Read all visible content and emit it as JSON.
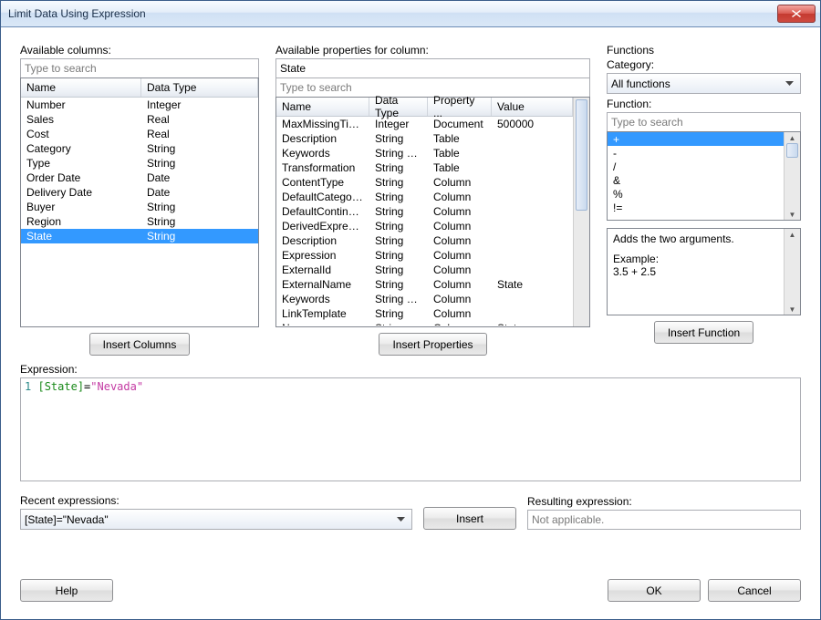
{
  "title": "Limit Data Using Expression",
  "available_columns": {
    "label": "Available columns:",
    "search_placeholder": "Type to search",
    "headers": {
      "name": "Name",
      "datatype": "Data Type"
    },
    "rows": [
      {
        "name": "Number",
        "datatype": "Integer",
        "sel": false
      },
      {
        "name": "Sales",
        "datatype": "Real",
        "sel": false
      },
      {
        "name": "Cost",
        "datatype": "Real",
        "sel": false
      },
      {
        "name": "Category",
        "datatype": "String",
        "sel": false
      },
      {
        "name": "Type",
        "datatype": "String",
        "sel": false
      },
      {
        "name": "Order Date",
        "datatype": "Date",
        "sel": false
      },
      {
        "name": "Delivery Date",
        "datatype": "Date",
        "sel": false
      },
      {
        "name": "Buyer",
        "datatype": "String",
        "sel": false
      },
      {
        "name": "Region",
        "datatype": "String",
        "sel": false
      },
      {
        "name": "State",
        "datatype": "String",
        "sel": true
      }
    ],
    "insert_btn": "Insert Columns"
  },
  "properties": {
    "label": "Available properties for column:",
    "column_name": "State",
    "search_placeholder": "Type to search",
    "headers": {
      "name": "Name",
      "datatype": "Data Type",
      "prop": "Property ...",
      "value": "Value"
    },
    "rows": [
      {
        "name": "MaxMissingTime...",
        "datatype": "Integer",
        "prop": "Document",
        "value": "500000"
      },
      {
        "name": "Description",
        "datatype": "String",
        "prop": "Table",
        "value": ""
      },
      {
        "name": "Keywords",
        "datatype": "String List",
        "prop": "Table",
        "value": ""
      },
      {
        "name": "Transformation",
        "datatype": "String",
        "prop": "Table",
        "value": ""
      },
      {
        "name": "ContentType",
        "datatype": "String",
        "prop": "Column",
        "value": ""
      },
      {
        "name": "DefaultCategoric...",
        "datatype": "String",
        "prop": "Column",
        "value": ""
      },
      {
        "name": "DefaultContinuou...",
        "datatype": "String",
        "prop": "Column",
        "value": ""
      },
      {
        "name": "DerivedExpression",
        "datatype": "String",
        "prop": "Column",
        "value": ""
      },
      {
        "name": "Description",
        "datatype": "String",
        "prop": "Column",
        "value": ""
      },
      {
        "name": "Expression",
        "datatype": "String",
        "prop": "Column",
        "value": ""
      },
      {
        "name": "ExternalId",
        "datatype": "String",
        "prop": "Column",
        "value": ""
      },
      {
        "name": "ExternalName",
        "datatype": "String",
        "prop": "Column",
        "value": "State"
      },
      {
        "name": "Keywords",
        "datatype": "String List",
        "prop": "Column",
        "value": ""
      },
      {
        "name": "LinkTemplate",
        "datatype": "String",
        "prop": "Column",
        "value": ""
      },
      {
        "name": "Name",
        "datatype": "String",
        "prop": "Column",
        "value": "State"
      }
    ],
    "insert_btn": "Insert Properties"
  },
  "functions": {
    "label": "Functions",
    "category_label": "Category:",
    "category_value": "All functions",
    "function_label": "Function:",
    "search_placeholder": "Type to search",
    "items": [
      "+",
      "-",
      "/",
      "&",
      "%",
      "!="
    ],
    "desc_line1": "Adds the two arguments.",
    "desc_line2": "Example:",
    "desc_line3": "3.5 + 2.5",
    "insert_btn": "Insert Function"
  },
  "expression": {
    "label": "Expression:",
    "line_no": "1",
    "col_token": "[State]",
    "eq_token": "=",
    "str_token": "\"Nevada\""
  },
  "recent": {
    "label": "Recent expressions:",
    "value": "[State]=\"Nevada\"",
    "insert_btn": "Insert"
  },
  "result": {
    "label": "Resulting expression:",
    "value": "Not applicable."
  },
  "buttons": {
    "help": "Help",
    "ok": "OK",
    "cancel": "Cancel"
  }
}
